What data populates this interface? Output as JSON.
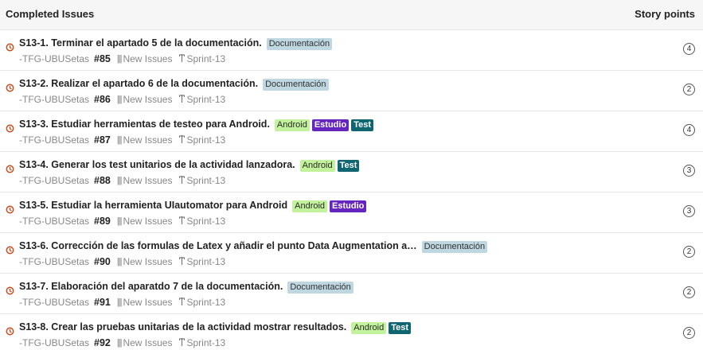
{
  "header": {
    "title": "Completed Issues",
    "points_label": "Story points"
  },
  "colors": {
    "status_icon": "#c8491b",
    "doc": "#bfd7e0",
    "android": "#c2f29b",
    "estudio": "#6426bf",
    "test": "#0f6570"
  },
  "issues": [
    {
      "title": "S13-1. Terminar el apartado 5 de la documentación.",
      "labels": [
        {
          "text": "Documentación",
          "type": "doc"
        }
      ],
      "repo": "-TFG-UBUSetas",
      "number": "#85",
      "pipeline": "New Issues",
      "sprint": "Sprint-13",
      "points": "4"
    },
    {
      "title": "S13-2. Realizar el apartado 6 de la documentación.",
      "labels": [
        {
          "text": "Documentación",
          "type": "doc"
        }
      ],
      "repo": "-TFG-UBUSetas",
      "number": "#86",
      "pipeline": "New Issues",
      "sprint": "Sprint-13",
      "points": "2"
    },
    {
      "title": "S13-3. Estudiar herramientas de testeo para Android.",
      "labels": [
        {
          "text": "Android",
          "type": "android"
        },
        {
          "text": "Estudio",
          "type": "estudio"
        },
        {
          "text": "Test",
          "type": "test"
        }
      ],
      "repo": "-TFG-UBUSetas",
      "number": "#87",
      "pipeline": "New Issues",
      "sprint": "Sprint-13",
      "points": "4"
    },
    {
      "title": "S13-4. Generar los test unitarios de la actividad lanzadora.",
      "labels": [
        {
          "text": "Android",
          "type": "android"
        },
        {
          "text": "Test",
          "type": "test"
        }
      ],
      "repo": "-TFG-UBUSetas",
      "number": "#88",
      "pipeline": "New Issues",
      "sprint": "Sprint-13",
      "points": "3"
    },
    {
      "title": "S13-5. Estudiar la herramienta UIautomator para Android",
      "labels": [
        {
          "text": "Android",
          "type": "android"
        },
        {
          "text": "Estudio",
          "type": "estudio"
        }
      ],
      "repo": "-TFG-UBUSetas",
      "number": "#89",
      "pipeline": "New Issues",
      "sprint": "Sprint-13",
      "points": "3"
    },
    {
      "title": "S13-6. Corrección de las formulas de Latex y añadir el punto Data Augmentation a…",
      "labels": [
        {
          "text": "Documentación",
          "type": "doc"
        }
      ],
      "repo": "-TFG-UBUSetas",
      "number": "#90",
      "pipeline": "New Issues",
      "sprint": "Sprint-13",
      "points": "2"
    },
    {
      "title": "S13-7. Elaboración del aparatdo 7 de la documentación.",
      "labels": [
        {
          "text": "Documentación",
          "type": "doc"
        }
      ],
      "repo": "-TFG-UBUSetas",
      "number": "#91",
      "pipeline": "New Issues",
      "sprint": "Sprint-13",
      "points": "2"
    },
    {
      "title": "S13-8. Crear las pruebas unitarias de la actividad mostrar resultados.",
      "labels": [
        {
          "text": "Android",
          "type": "android"
        },
        {
          "text": "Test",
          "type": "test"
        }
      ],
      "repo": "-TFG-UBUSetas",
      "number": "#92",
      "pipeline": "New Issues",
      "sprint": "Sprint-13",
      "points": "2"
    }
  ]
}
